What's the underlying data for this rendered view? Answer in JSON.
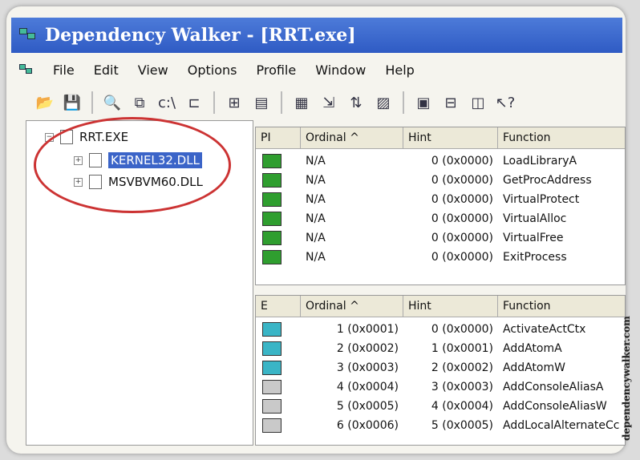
{
  "window": {
    "title": "Dependency Walker - [RRT.exe]"
  },
  "menu": [
    "File",
    "Edit",
    "View",
    "Options",
    "Profile",
    "Window",
    "Help"
  ],
  "toolbar": {
    "icons": [
      "open-icon",
      "save-icon",
      "find-icon",
      "copy-icon",
      "full-path-icon",
      "undecorate-icon",
      "tree-expand-icon",
      "properties-icon",
      "highlight-icon",
      "find-next-icon",
      "tile-icon",
      "cascade-icon",
      "split-icon",
      "window-icon",
      "help-icon"
    ]
  },
  "tree": {
    "root": "RRT.EXE",
    "children": [
      "KERNEL32.DLL",
      "MSVBVM60.DLL"
    ]
  },
  "imports": {
    "headers": [
      "PI",
      "Ordinal ^",
      "Hint",
      "Function"
    ],
    "rows": [
      {
        "ordinal": "N/A",
        "hint": "0 (0x0000)",
        "function": "LoadLibraryA"
      },
      {
        "ordinal": "N/A",
        "hint": "0 (0x0000)",
        "function": "GetProcAddress"
      },
      {
        "ordinal": "N/A",
        "hint": "0 (0x0000)",
        "function": "VirtualProtect"
      },
      {
        "ordinal": "N/A",
        "hint": "0 (0x0000)",
        "function": "VirtualAlloc"
      },
      {
        "ordinal": "N/A",
        "hint": "0 (0x0000)",
        "function": "VirtualFree"
      },
      {
        "ordinal": "N/A",
        "hint": "0 (0x0000)",
        "function": "ExitProcess"
      }
    ]
  },
  "exports": {
    "headers": [
      "E",
      "Ordinal ^",
      "Hint",
      "Function"
    ],
    "rows": [
      {
        "ordinal": "1 (0x0001)",
        "hint": "0 (0x0000)",
        "function": "ActivateActCtx",
        "badge": "teal"
      },
      {
        "ordinal": "2 (0x0002)",
        "hint": "1 (0x0001)",
        "function": "AddAtomA",
        "badge": "teal"
      },
      {
        "ordinal": "3 (0x0003)",
        "hint": "2 (0x0002)",
        "function": "AddAtomW",
        "badge": "teal"
      },
      {
        "ordinal": "4 (0x0004)",
        "hint": "3 (0x0003)",
        "function": "AddConsoleAliasA",
        "badge": "gray"
      },
      {
        "ordinal": "5 (0x0005)",
        "hint": "4 (0x0004)",
        "function": "AddConsoleAliasW",
        "badge": "gray"
      },
      {
        "ordinal": "6 (0x0006)",
        "hint": "5 (0x0005)",
        "function": "AddLocalAlternateCc",
        "badge": "gray"
      }
    ]
  },
  "watermark": "dependencywalker.com",
  "colors": {
    "titlebar": "#2f5bc4",
    "selection": "#3b64c8",
    "annotation": "#cc3333"
  }
}
